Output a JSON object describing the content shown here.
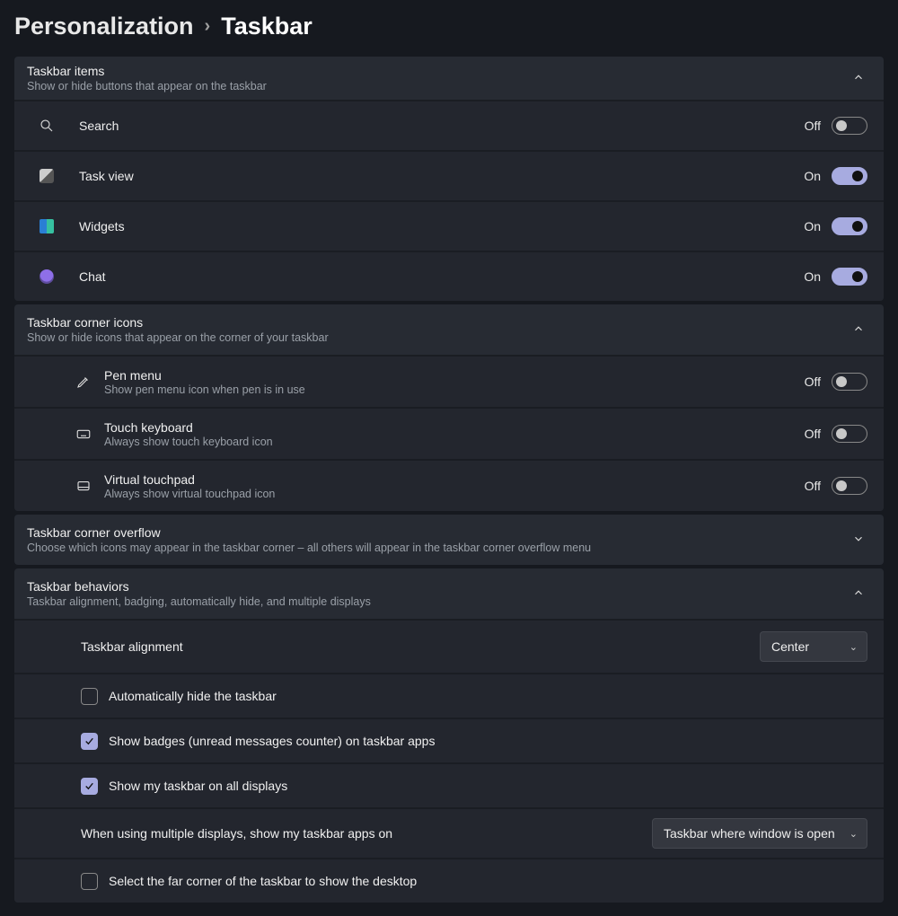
{
  "breadcrumb": {
    "parent": "Personalization",
    "current": "Taskbar"
  },
  "state": {
    "on": "On",
    "off": "Off"
  },
  "sections": {
    "items": {
      "title": "Taskbar items",
      "sub": "Show or hide buttons that appear on the taskbar",
      "rows": {
        "search": {
          "label": "Search",
          "value": "Off"
        },
        "taskview": {
          "label": "Task view",
          "value": "On"
        },
        "widgets": {
          "label": "Widgets",
          "value": "On"
        },
        "chat": {
          "label": "Chat",
          "value": "On"
        }
      }
    },
    "corner": {
      "title": "Taskbar corner icons",
      "sub": "Show or hide icons that appear on the corner of your taskbar",
      "rows": {
        "pen": {
          "label": "Pen menu",
          "sub": "Show pen menu icon when pen is in use",
          "value": "Off"
        },
        "touchkb": {
          "label": "Touch keyboard",
          "sub": "Always show touch keyboard icon",
          "value": "Off"
        },
        "touchpad": {
          "label": "Virtual touchpad",
          "sub": "Always show virtual touchpad icon",
          "value": "Off"
        }
      }
    },
    "overflow": {
      "title": "Taskbar corner overflow",
      "sub": "Choose which icons may appear in the taskbar corner – all others will appear in the taskbar corner overflow menu"
    },
    "behaviors": {
      "title": "Taskbar behaviors",
      "sub": "Taskbar alignment, badging, automatically hide, and multiple displays",
      "alignment": {
        "label": "Taskbar alignment",
        "value": "Center"
      },
      "autohide": {
        "label": "Automatically hide the taskbar",
        "checked": false
      },
      "badges": {
        "label": "Show badges (unread messages counter) on taskbar apps",
        "checked": true
      },
      "alldisp": {
        "label": "Show my taskbar on all displays",
        "checked": true
      },
      "multi": {
        "label": "When using multiple displays, show my taskbar apps on",
        "value": "Taskbar where window is open"
      },
      "farcorner": {
        "label": "Select the far corner of the taskbar to show the desktop",
        "checked": false
      }
    }
  }
}
